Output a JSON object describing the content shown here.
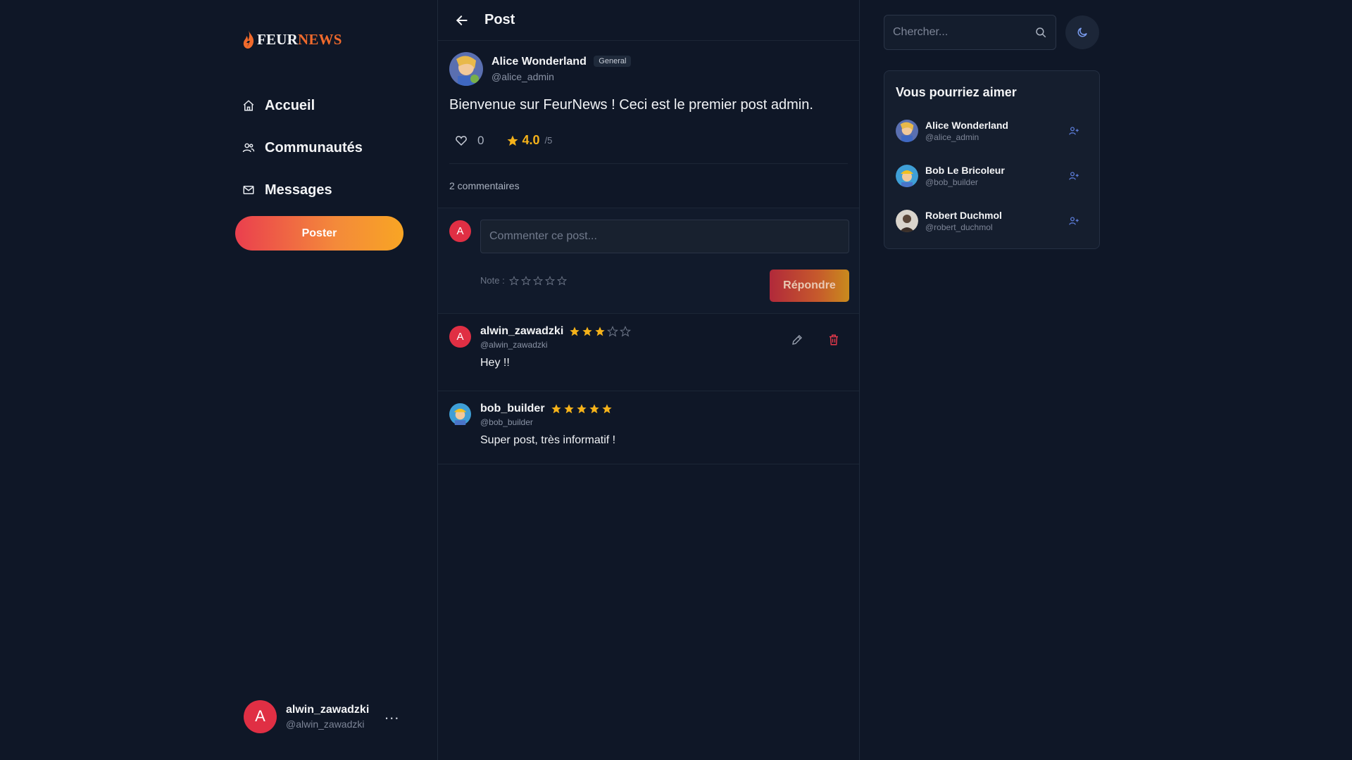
{
  "app": {
    "logo_part1": "FEUR",
    "logo_part2": "NEWS"
  },
  "nav": {
    "items": [
      {
        "label": "Accueil",
        "icon": "home-icon"
      },
      {
        "label": "Communautés",
        "icon": "users-icon"
      },
      {
        "label": "Messages",
        "icon": "mail-icon"
      }
    ],
    "post_button": "Poster"
  },
  "current_user": {
    "initial": "A",
    "name": "alwin_zawadzki",
    "handle": "@alwin_zawadzki",
    "more": "..."
  },
  "page": {
    "title": "Post"
  },
  "post": {
    "author": "Alice Wonderland",
    "tag": "General",
    "handle": "@alice_admin",
    "body": "Bienvenue sur FeurNews ! Ceci est le premier post admin.",
    "likes": "0",
    "rating": "4.0",
    "rating_max": "/5",
    "comment_count": "2 commentaires"
  },
  "composer": {
    "initial": "A",
    "placeholder": "Commenter ce post...",
    "note_label": "Note :",
    "reply_label": "Répondre"
  },
  "comments": [
    {
      "initial": "A",
      "name": "alwin_zawadzki",
      "stars": 3,
      "handle": "@alwin_zawadzki",
      "text": "Hey !!"
    },
    {
      "name": "bob_builder",
      "stars": 5,
      "handle": "@bob_builder",
      "text": "Super post, très informatif !"
    }
  ],
  "search": {
    "placeholder": "Chercher..."
  },
  "suggestions": {
    "title": "Vous pourriez aimer",
    "users": [
      {
        "name": "Alice Wonderland",
        "handle": "@alice_admin"
      },
      {
        "name": "Bob Le Bricoleur",
        "handle": "@bob_builder"
      },
      {
        "name": "Robert Duchmol",
        "handle": "@robert_duchmol"
      }
    ]
  },
  "colors": {
    "background": "#0f1727",
    "accent_red": "#e02f44",
    "accent_orange": "#f8a524",
    "star": "#f5b21a",
    "follow_icon": "#5b7bd6"
  }
}
